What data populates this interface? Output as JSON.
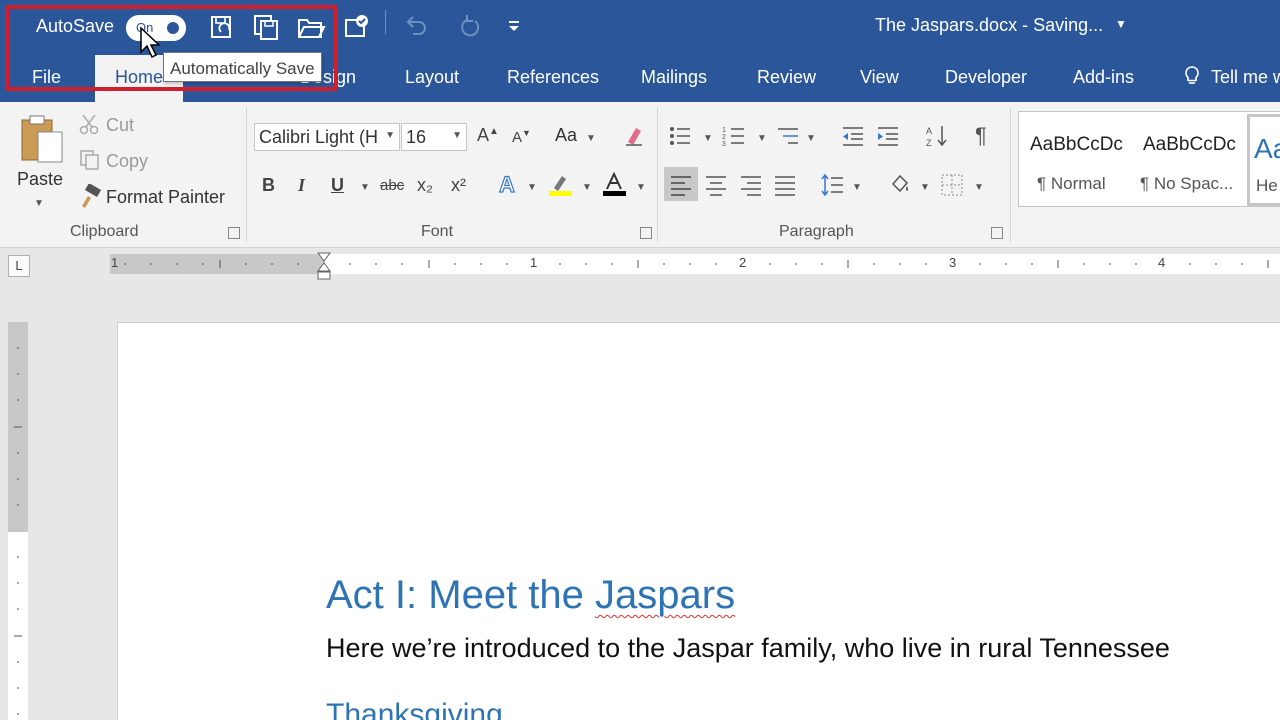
{
  "title_bar": {
    "autosave_label": "AutoSave",
    "toggle_state": "On",
    "document_title": "The Jaspars.docx  -  Saving...",
    "brand_color": "#2b579a"
  },
  "qat_icons": [
    "save-refresh-icon",
    "save-copy-icon",
    "open-folder-icon",
    "touch-mode-icon",
    "undo-icon",
    "redo-icon",
    "customize-qat-icon"
  ],
  "tooltip": "Automatically Save",
  "tabs": [
    "File",
    "Home",
    "Design",
    "Layout",
    "References",
    "Mailings",
    "Review",
    "View",
    "Developer",
    "Add-ins",
    "Tell me w"
  ],
  "clipboard": {
    "paste": "Paste",
    "cut": "Cut",
    "copy": "Copy",
    "format_painter": "Format Painter",
    "group": "Clipboard"
  },
  "font": {
    "name": "Calibri Light (H",
    "size": "16",
    "case_label": "Aa",
    "bold": "B",
    "italic": "I",
    "underline": "U",
    "strikethrough": "abc",
    "subscript": "x₂",
    "superscript": "x²",
    "group": "Font"
  },
  "paragraph": {
    "group": "Paragraph"
  },
  "styles": [
    {
      "sample": "AaBbCcDc",
      "name": "¶ Normal"
    },
    {
      "sample": "AaBbCcDc",
      "name": "¶ No Spac..."
    },
    {
      "sample": "Aa",
      "name": "He"
    }
  ],
  "ruler_numbers": [
    "1",
    "1",
    "2",
    "3",
    "4"
  ],
  "document": {
    "heading1": "Act I: Meet the ",
    "heading1_misspelled": "Jaspars",
    "body": "Here we’re introduced to the Jaspar family, who live in rural Tennessee",
    "heading2": "Thanksgiving"
  }
}
